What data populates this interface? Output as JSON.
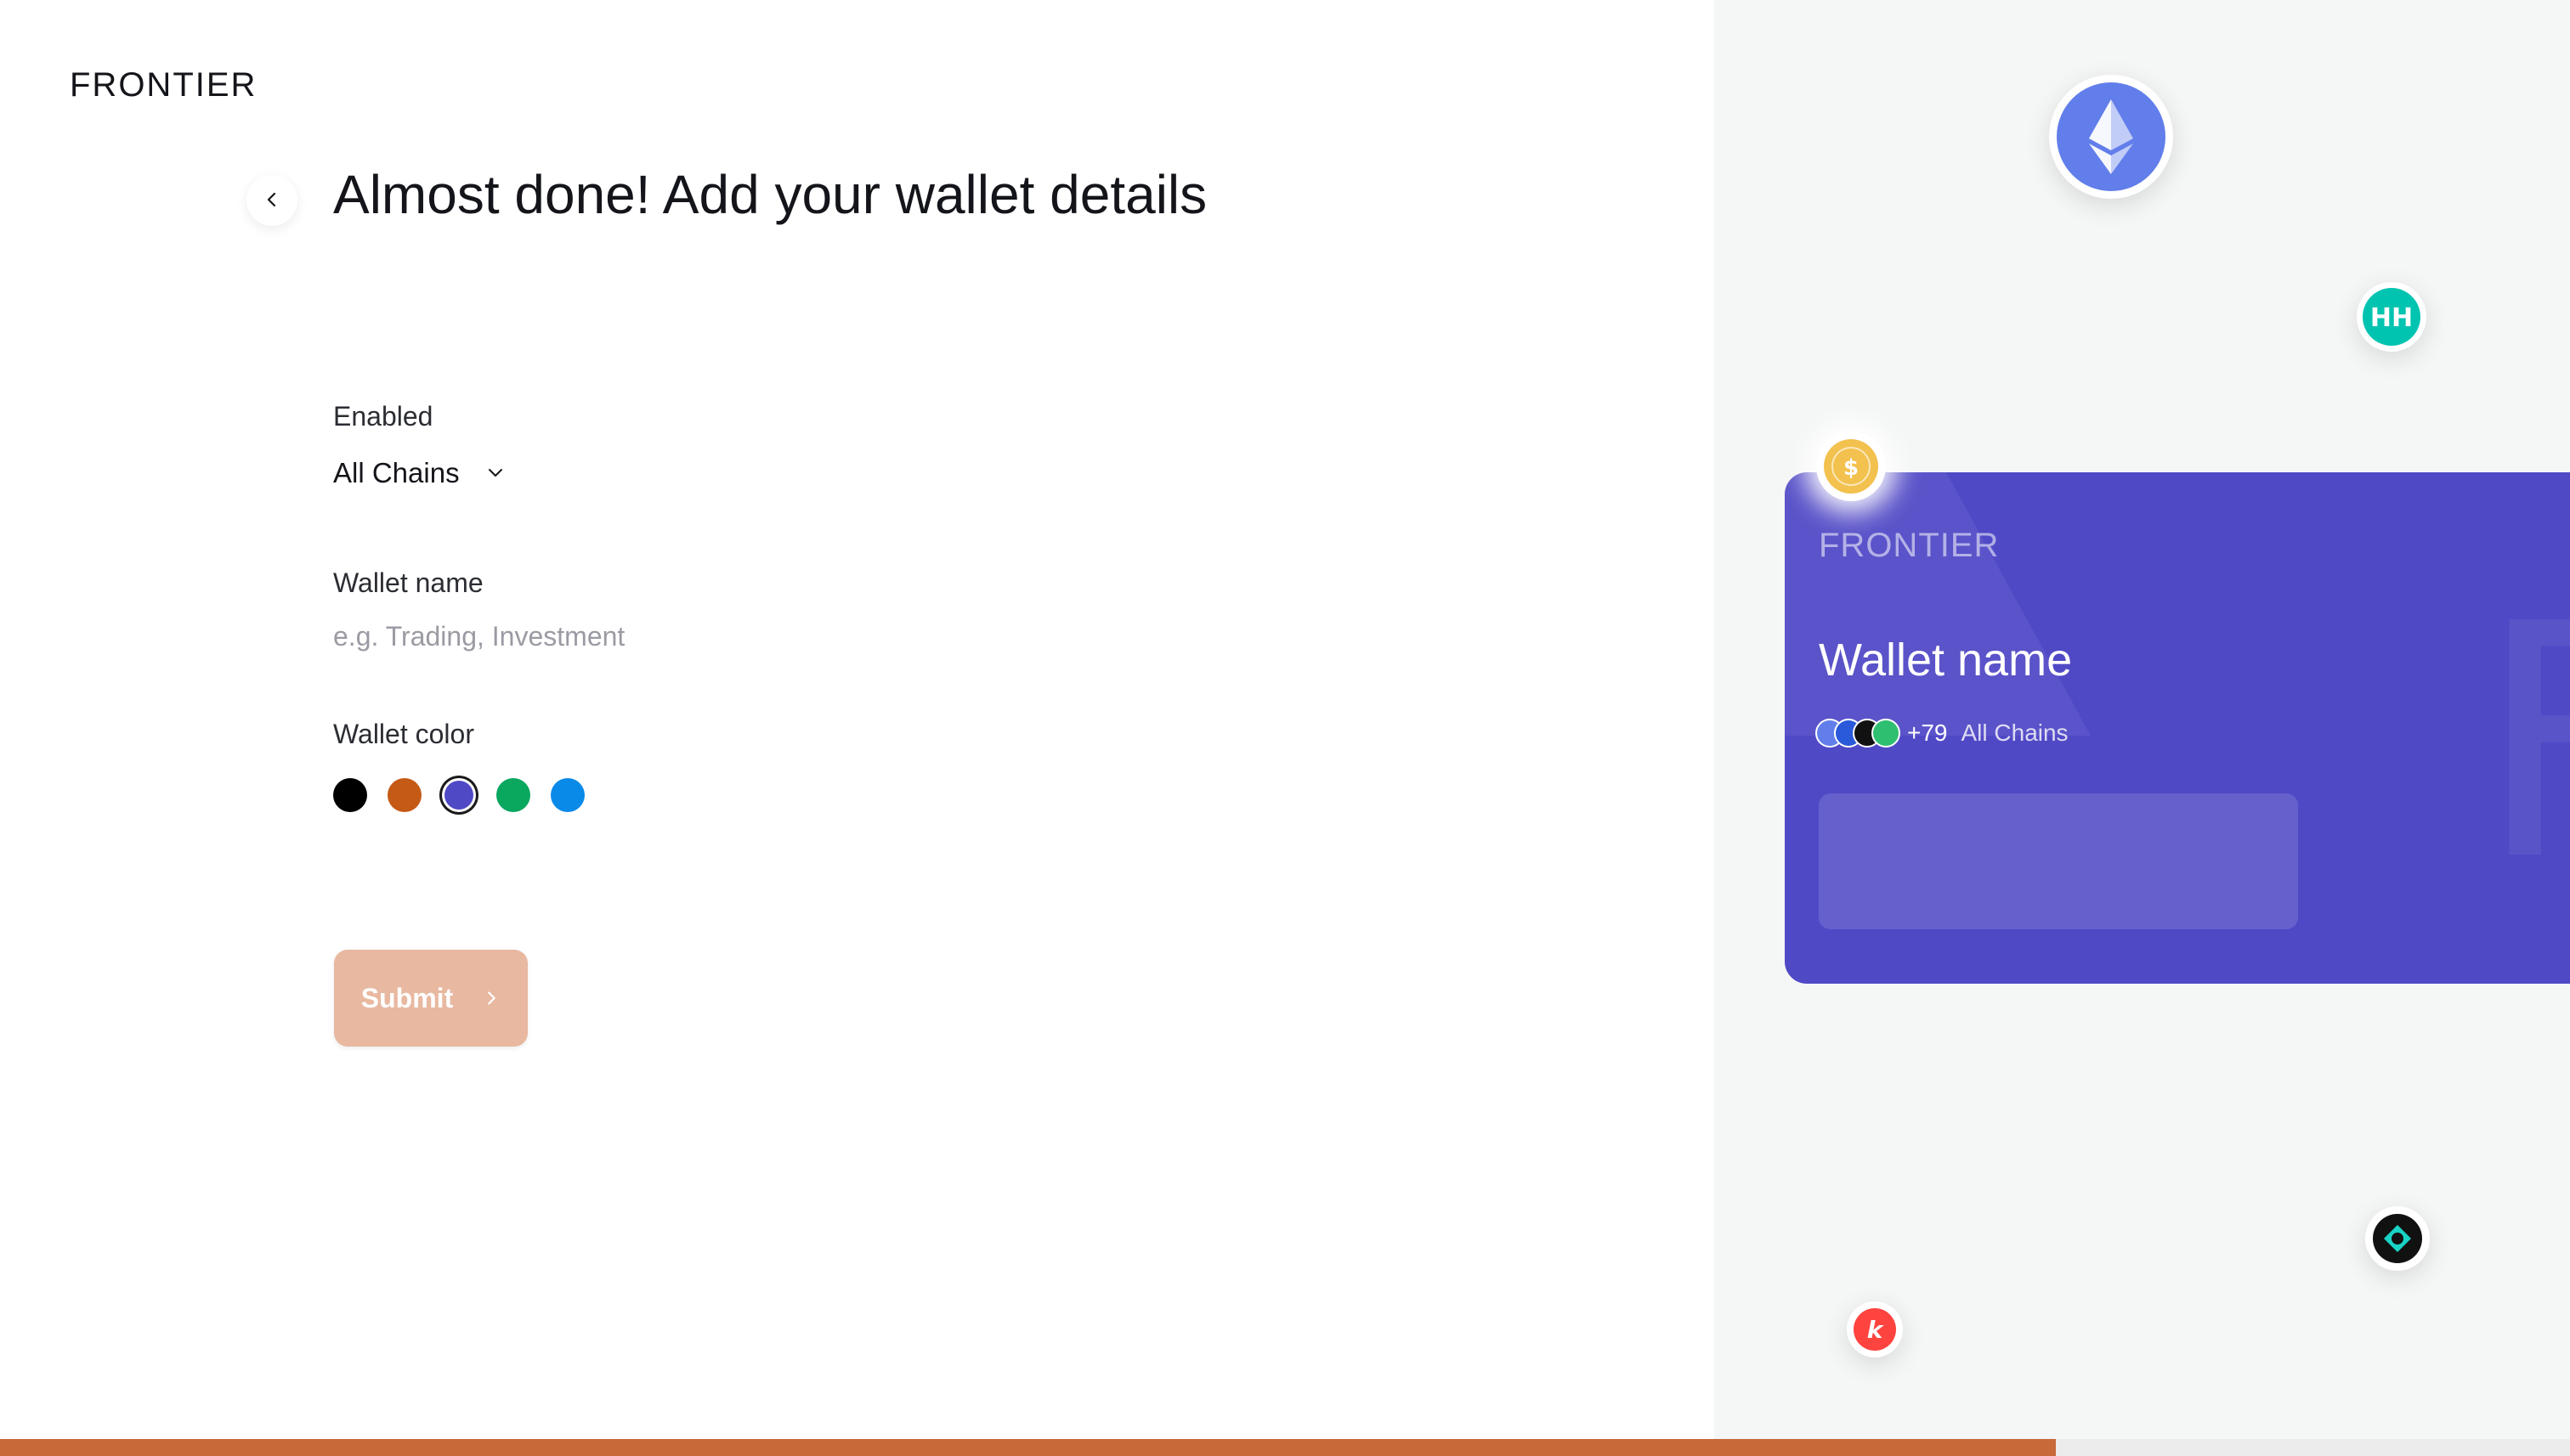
{
  "brand": {
    "logo_text": "FRONTIER"
  },
  "page": {
    "title": "Almost done! Add your wallet details"
  },
  "form": {
    "enabled_label": "Enabled",
    "enabled_value": "All Chains",
    "wallet_name_label": "Wallet name",
    "wallet_name_value": "",
    "wallet_name_placeholder": "e.g. Trading, Investment",
    "wallet_color_label": "Wallet color",
    "colors": [
      "#000000",
      "#c55a16",
      "#5049c6",
      "#0aa85f",
      "#0a8ae8"
    ],
    "selected_color_index": 2,
    "submit_label": "Submit"
  },
  "preview_card": {
    "brand": "FRONTIER",
    "wallet_name": "Wallet name",
    "chain_count": "+79",
    "chains_label": "All Chains",
    "color": "#5049c6"
  },
  "progress": {
    "fraction": 0.8
  },
  "icons": {
    "back": "chevron-left-icon",
    "dropdown": "chevron-down-icon",
    "submit": "chevron-right-icon",
    "floating": [
      "ethereum-icon",
      "harmony-icon",
      "usd-coin-icon",
      "kava-icon",
      "dforce-icon"
    ]
  }
}
